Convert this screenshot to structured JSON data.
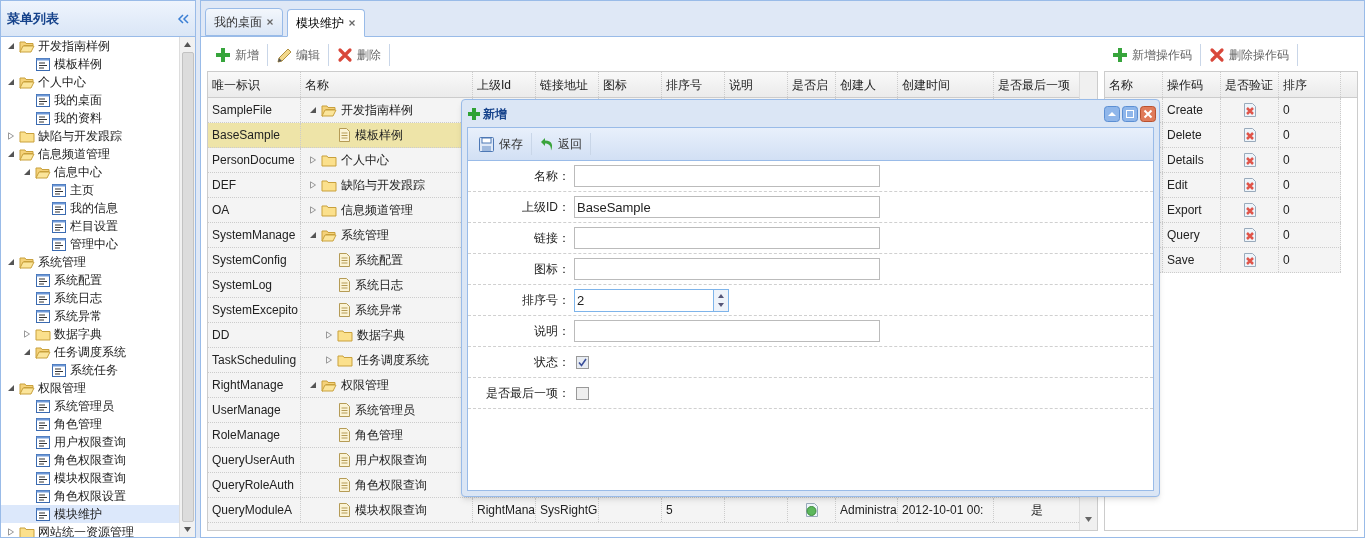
{
  "sidebar": {
    "title": "菜单列表",
    "items": [
      {
        "label": "开发指南样例",
        "kind": "folder",
        "expanded": true,
        "selected": false,
        "children": [
          {
            "label": "模板样例",
            "kind": "page",
            "selected": false
          }
        ]
      },
      {
        "label": "个人中心",
        "kind": "folder",
        "expanded": true,
        "selected": false,
        "children": [
          {
            "label": "我的桌面",
            "kind": "page",
            "selected": false
          },
          {
            "label": "我的资料",
            "kind": "page",
            "selected": false
          }
        ]
      },
      {
        "label": "缺陷与开发跟踪",
        "kind": "folder",
        "expanded": false,
        "selected": false
      },
      {
        "label": "信息频道管理",
        "kind": "folder",
        "expanded": true,
        "selected": false,
        "children": [
          {
            "label": "信息中心",
            "kind": "folder",
            "expanded": true,
            "selected": false,
            "children": [
              {
                "label": "主页",
                "kind": "page",
                "selected": false
              },
              {
                "label": "我的信息",
                "kind": "page",
                "selected": false
              },
              {
                "label": "栏目设置",
                "kind": "page",
                "selected": false
              },
              {
                "label": "管理中心",
                "kind": "page",
                "selected": false
              }
            ]
          }
        ]
      },
      {
        "label": "系统管理",
        "kind": "folder",
        "expanded": true,
        "selected": false,
        "children": [
          {
            "label": "系统配置",
            "kind": "page",
            "selected": false
          },
          {
            "label": "系统日志",
            "kind": "page",
            "selected": false
          },
          {
            "label": "系统异常",
            "kind": "page",
            "selected": false
          },
          {
            "label": "数据字典",
            "kind": "folder",
            "expanded": false,
            "selected": false
          },
          {
            "label": "任务调度系统",
            "kind": "folder",
            "expanded": true,
            "selected": false,
            "children": [
              {
                "label": "系统任务",
                "kind": "page",
                "selected": false
              }
            ]
          }
        ]
      },
      {
        "label": "权限管理",
        "kind": "folder",
        "expanded": true,
        "selected": false,
        "children": [
          {
            "label": "系统管理员",
            "kind": "page",
            "selected": false
          },
          {
            "label": "角色管理",
            "kind": "page",
            "selected": false
          },
          {
            "label": "用户权限查询",
            "kind": "page",
            "selected": false
          },
          {
            "label": "角色权限查询",
            "kind": "page",
            "selected": false
          },
          {
            "label": "模块权限查询",
            "kind": "page",
            "selected": false
          },
          {
            "label": "角色权限设置",
            "kind": "page",
            "selected": false
          },
          {
            "label": "模块维护",
            "kind": "page",
            "selected": true
          }
        ]
      },
      {
        "label": "网站统一资源管理",
        "kind": "folder",
        "expanded": false,
        "selected": false
      }
    ]
  },
  "tabs": [
    {
      "label": "我的桌面",
      "selected": false
    },
    {
      "label": "模块维护",
      "selected": true
    }
  ],
  "toolbar": [
    {
      "label": "新增",
      "kind": "add"
    },
    {
      "label": "编辑",
      "kind": "edit"
    },
    {
      "label": "删除",
      "kind": "delete"
    }
  ],
  "grid": {
    "columns": [
      "唯一标识",
      "名称",
      "上级Id",
      "链接地址",
      "图标",
      "排序号",
      "说明",
      "是否启",
      "创建人",
      "创建时间",
      "是否最后一项"
    ],
    "rows": [
      {
        "id": "SampleFile",
        "name": "开发指南样例",
        "kind": "folder",
        "expanded": true,
        "selected": false,
        "children": [
          {
            "id": "BaseSample",
            "name": "模板样例",
            "kind": "page",
            "selected": true
          }
        ]
      },
      {
        "id": "PersonDocume",
        "name": "个人中心",
        "kind": "folder",
        "expanded": false,
        "selected": false
      },
      {
        "id": "DEF",
        "name": "缺陷与开发跟踪",
        "kind": "folder",
        "expanded": false,
        "selected": false
      },
      {
        "id": "OA",
        "name": "信息频道管理",
        "kind": "folder",
        "expanded": false,
        "selected": false
      },
      {
        "id": "SystemManage",
        "name": "系统管理",
        "kind": "folder",
        "expanded": true,
        "selected": false,
        "children": [
          {
            "id": "SystemConfig",
            "name": "系统配置",
            "kind": "page",
            "selected": false
          },
          {
            "id": "SystemLog",
            "name": "系统日志",
            "kind": "page",
            "selected": false
          },
          {
            "id": "SystemExcepito",
            "name": "系统异常",
            "kind": "page",
            "selected": false
          },
          {
            "id": "DD",
            "name": "数据字典",
            "kind": "folder",
            "expanded": false,
            "selected": false
          },
          {
            "id": "TaskScheduling",
            "name": "任务调度系统",
            "kind": "folder",
            "expanded": false,
            "selected": false
          }
        ]
      },
      {
        "id": "RightManage",
        "name": "权限管理",
        "kind": "folder",
        "expanded": true,
        "selected": false,
        "children": [
          {
            "id": "UserManage",
            "name": "系统管理员",
            "kind": "page",
            "selected": false
          },
          {
            "id": "RoleManage",
            "name": "角色管理",
            "kind": "page",
            "selected": false
          },
          {
            "id": "QueryUserAuth",
            "name": "用户权限查询",
            "kind": "page",
            "selected": false
          },
          {
            "id": "QueryRoleAuth",
            "name": "角色权限查询",
            "kind": "page",
            "selected": false
          },
          {
            "id": "QueryModuleA",
            "name": "模块权限查询",
            "kind": "page",
            "selected": false,
            "parent_id": "RightMana",
            "link": "SysRightG",
            "sort": "5",
            "enabled": true,
            "creator": "Administra",
            "created": "2012-10-01 00:",
            "is_last": "是"
          }
        ]
      }
    ]
  },
  "op_toolbar": [
    {
      "label": "新增操作码",
      "kind": "add"
    },
    {
      "label": "删除操作码",
      "kind": "delete"
    }
  ],
  "op_grid": {
    "columns": [
      "名称",
      "操作码",
      "是否验证",
      "排序"
    ],
    "rows": [
      {
        "code": "Create",
        "verified": false,
        "sort": "0"
      },
      {
        "code": "Delete",
        "verified": false,
        "sort": "0"
      },
      {
        "code": "Details",
        "verified": false,
        "sort": "0"
      },
      {
        "code": "Edit",
        "verified": false,
        "sort": "0"
      },
      {
        "code": "Export",
        "verified": false,
        "sort": "0"
      },
      {
        "code": "Query",
        "verified": false,
        "sort": "0"
      },
      {
        "code": "Save",
        "verified": false,
        "sort": "0"
      }
    ]
  },
  "dialog": {
    "title": "新增",
    "toolbar": [
      {
        "label": "保存",
        "kind": "save"
      },
      {
        "label": "返回",
        "kind": "back"
      }
    ],
    "fields": [
      {
        "label": "名称：",
        "kind": "text"
      },
      {
        "label": "上级ID：",
        "kind": "text",
        "value": "BaseSample"
      },
      {
        "label": "链接：",
        "kind": "text"
      },
      {
        "label": "图标：",
        "kind": "text"
      },
      {
        "label": "排序号：",
        "kind": "spinner",
        "value": "2"
      },
      {
        "label": "说明：",
        "kind": "text"
      },
      {
        "label": "状态：",
        "kind": "checkbox",
        "checked": true
      },
      {
        "label": "是否最后一项：",
        "kind": "checkbox",
        "checked": false
      }
    ]
  }
}
